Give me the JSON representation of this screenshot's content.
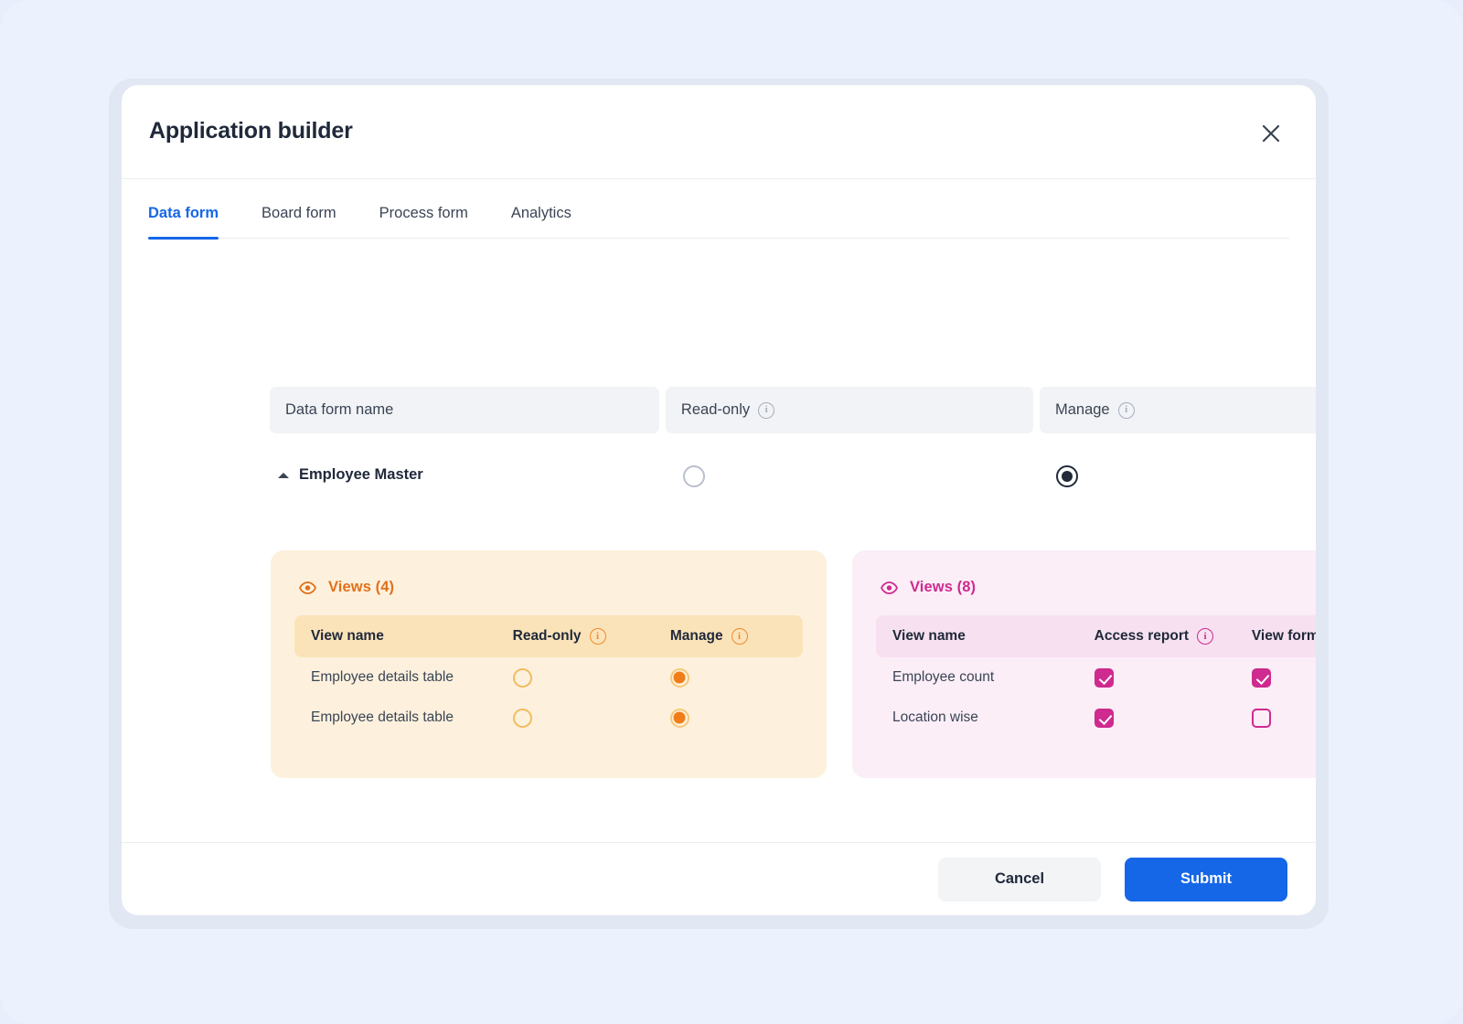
{
  "theme": {
    "page_bg": "#ebf1fd",
    "accent_blue": "#1567e8",
    "accent_orange": "#e2701a",
    "accent_pink": "#cf2a8f",
    "text_dark": "#20293a"
  },
  "dialog": {
    "title": "Application builder",
    "close_icon": "close-icon"
  },
  "tabs": [
    {
      "label": "Data form",
      "active": true
    },
    {
      "label": "Board form",
      "active": false
    },
    {
      "label": "Process form",
      "active": false
    },
    {
      "label": "Analytics",
      "active": false
    }
  ],
  "column_headers": [
    {
      "label": "Data form name",
      "info": false
    },
    {
      "label": "Read-only",
      "info": true,
      "info_icon": "info-icon"
    },
    {
      "label": "Manage",
      "info": true,
      "info_icon": "info-icon"
    }
  ],
  "form_row": {
    "caret_icon": "caret-up-icon",
    "name": "Employee Master",
    "read_only_selected": false,
    "manage_selected": true
  },
  "panels": [
    {
      "id": "views-orange",
      "eye_icon": "eye-icon",
      "title": "Views (4)",
      "columns": [
        {
          "label": "View name",
          "info": false
        },
        {
          "label": "Read-only",
          "info": true,
          "info_icon": "info-icon"
        },
        {
          "label": "Manage",
          "info": true,
          "info_icon": "info-icon"
        }
      ],
      "rows": [
        {
          "name": "Employee details table",
          "col2": false,
          "col3": true
        },
        {
          "name": "Employee details table",
          "col2": false,
          "col3": true
        }
      ]
    },
    {
      "id": "views-pink",
      "eye_icon": "eye-icon",
      "title": "Views (8)",
      "columns": [
        {
          "label": "View name",
          "info": false
        },
        {
          "label": "Access report",
          "info": true,
          "info_icon": "info-icon"
        },
        {
          "label": "View form",
          "info": true,
          "info_icon": "info-icon"
        }
      ],
      "rows": [
        {
          "name": "Employee count",
          "col2": true,
          "col3": true
        },
        {
          "name": "Location wise",
          "col2": true,
          "col3": false
        }
      ]
    }
  ],
  "footer": {
    "cancel_label": "Cancel",
    "submit_label": "Submit"
  }
}
